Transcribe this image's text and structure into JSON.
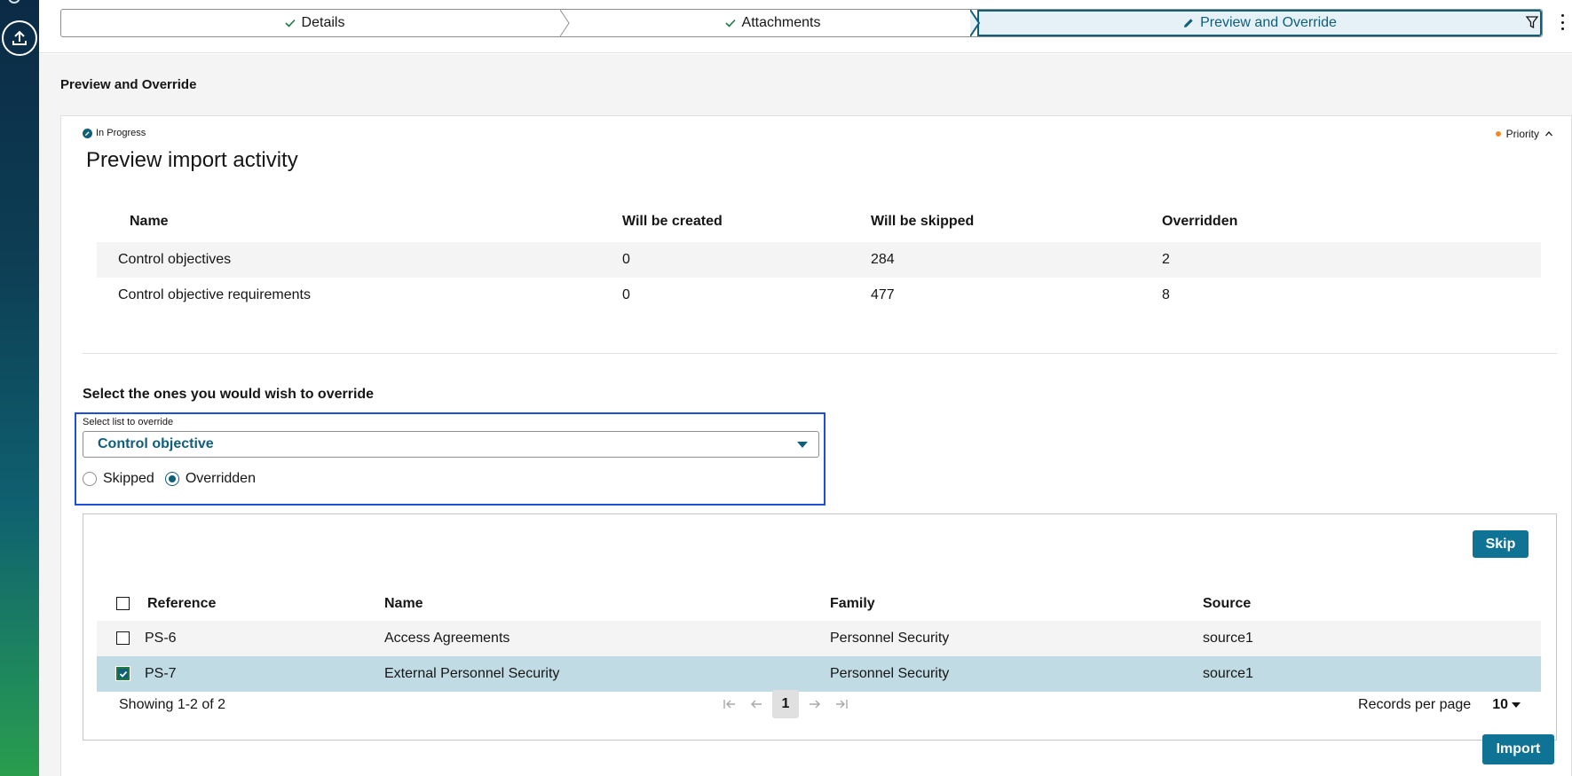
{
  "stepper": {
    "steps": [
      {
        "label": "Details"
      },
      {
        "label": "Attachments"
      },
      {
        "label": "Preview and Override"
      }
    ]
  },
  "page": {
    "title": "Preview and Override"
  },
  "card": {
    "status": "In Progress",
    "priority": "Priority",
    "title": "Preview import activity"
  },
  "summary": {
    "columns": [
      "Name",
      "Will be created",
      "Will be skipped",
      "Overridden"
    ],
    "rows": [
      [
        "Control objectives",
        "0",
        "284",
        "2"
      ],
      [
        "Control objective requirements",
        "0",
        "477",
        "8"
      ]
    ]
  },
  "override": {
    "heading": "Select the ones you would wish to override",
    "dropdown_label": "Select list to override",
    "dropdown_value": "Control objective",
    "radio_skipped": "Skipped",
    "radio_overridden": "Overridden",
    "selected_radio": "Overridden"
  },
  "records": {
    "skip_label": "Skip",
    "columns": [
      "Reference",
      "Name",
      "Family",
      "Source"
    ],
    "rows": [
      {
        "checked": false,
        "cells": [
          "PS-6",
          "Access Agreements",
          "Personnel Security",
          "source1"
        ]
      },
      {
        "checked": true,
        "cells": [
          "PS-7",
          "External Personnel Security",
          "Personnel Security",
          "source1"
        ]
      }
    ],
    "showing": "Showing 1-2 of 2",
    "current_page": "1",
    "records_per_page_label": "Records per page",
    "records_per_page": "10"
  },
  "import_label": "Import",
  "colors": {
    "accent": "#0f7396",
    "highlight_border": "#1f4fd8",
    "selected_row": "#c0dbe3",
    "priority": "#f08a24"
  }
}
